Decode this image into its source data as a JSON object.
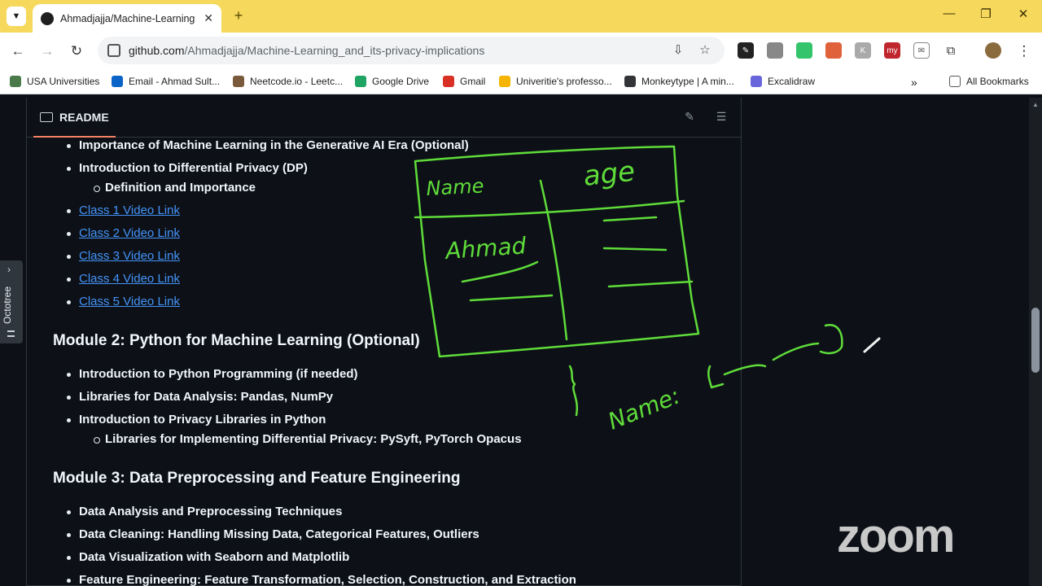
{
  "browser": {
    "tab_title": "Ahmadjajja/Machine-Learning",
    "tab_close": "✕",
    "new_tab": "+",
    "url_host": "github.com",
    "url_path": "/Ahmadjajja/Machine-Learning_and_its-privacy-implications",
    "bookmarks": [
      {
        "label": "USA Universities",
        "icon_color": "#4a7a4a"
      },
      {
        "label": "Email - Ahmad Sult...",
        "icon_color": "#0a64c8"
      },
      {
        "label": "Neetcode.io - Leetc...",
        "icon_color": "#7a5a3a"
      },
      {
        "label": "Google Drive",
        "icon_color": "#1fa463"
      },
      {
        "label": "Gmail",
        "icon_color": "#d93025"
      },
      {
        "label": "Univeritie's professo...",
        "icon_color": "#f4b400"
      },
      {
        "label": "Monkeytype | A min...",
        "icon_color": "#323437"
      },
      {
        "label": "Excalidraw",
        "icon_color": "#6965db"
      }
    ],
    "more_bookmarks": "»",
    "all_bookmarks": "All Bookmarks"
  },
  "readme": {
    "tab_label": "README",
    "items_top": [
      {
        "text": "Importance of Machine Learning in the Generative AI Era (Optional)",
        "type": "bullet"
      },
      {
        "text": "Introduction to Differential Privacy (DP)",
        "type": "bullet"
      },
      {
        "text": "Definition and Importance",
        "type": "sub"
      },
      {
        "text": "Class 1 Video Link",
        "type": "link"
      },
      {
        "text": "Class 2 Video Link",
        "type": "link"
      },
      {
        "text": "Class 3 Video Link",
        "type": "link"
      },
      {
        "text": "Class 4 Video Link",
        "type": "link"
      },
      {
        "text": "Class 5 Video Link",
        "type": "link"
      }
    ],
    "module2_title": "Module 2: Python for Machine Learning (Optional)",
    "module2_items": [
      {
        "text": "Introduction to Python Programming (if needed)",
        "type": "bullet"
      },
      {
        "text": "Libraries for Data Analysis: Pandas, NumPy",
        "type": "bullet"
      },
      {
        "text": "Introduction to Privacy Libraries in Python",
        "type": "bullet"
      },
      {
        "text": "Libraries for Implementing Differential Privacy: PySyft, PyTorch Opacus",
        "type": "sub"
      }
    ],
    "module3_title": "Module 3: Data Preprocessing and Feature Engineering",
    "module3_items": [
      {
        "text": "Data Analysis and Preprocessing Techniques",
        "type": "bullet"
      },
      {
        "text": "Data Cleaning: Handling Missing Data, Categorical Features, Outliers",
        "type": "bullet"
      },
      {
        "text": "Data Visualization with Seaborn and Matplotlib",
        "type": "bullet"
      },
      {
        "text": "Feature Engineering: Feature Transformation, Selection, Construction, and Extraction",
        "type": "bullet"
      }
    ]
  },
  "octotree": {
    "label": "Octotree"
  },
  "annotation": {
    "color": "#5fdc3a",
    "words": {
      "col1": "Name",
      "col2": "age",
      "cell": "Ahmad",
      "dict_key": "Name:"
    }
  },
  "overlay": {
    "logo": "zoom"
  },
  "colors": {
    "link": "#4493f8",
    "tab_strip": "#f6d85c",
    "page_bg": "#0d1117",
    "tab_underline": "#f78166"
  }
}
